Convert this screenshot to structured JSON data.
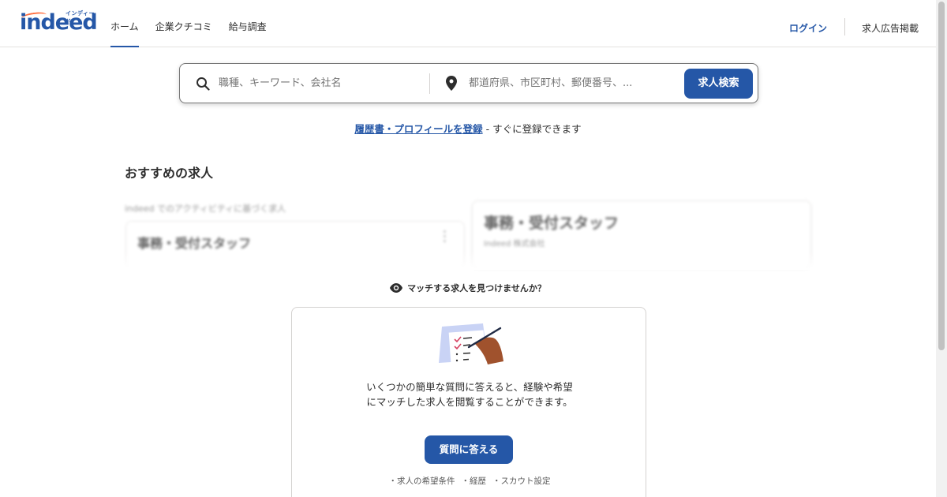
{
  "header": {
    "logo_text": "indeed",
    "logo_kana": "インディード",
    "nav": [
      {
        "label": "ホーム",
        "active": true
      },
      {
        "label": "企業クチコミ",
        "active": false
      },
      {
        "label": "給与調査",
        "active": false
      }
    ],
    "login_label": "ログイン",
    "employer_label": "求人広告掲載"
  },
  "search": {
    "what_placeholder": "職種、キーワード、会社名",
    "where_placeholder": "都道府県、市区町村、郵便番号、...",
    "button_label": "求人検索",
    "what_icon": "search-icon",
    "where_icon": "location-pin-icon"
  },
  "resume": {
    "link_text": "履歴書・プロフィールを登録",
    "rest_text": " - すぐに登録できます"
  },
  "recommended": {
    "title": "おすすめの求人",
    "subheading": "indeed でのアクティビティに基づく求人",
    "cards": [
      {
        "title": "事務・受付スタッフ"
      },
      {
        "title": "事務・受付スタッフ",
        "company": "Indeed 株式会社"
      }
    ]
  },
  "match": {
    "text": "マッチする求人を見つけませんか？",
    "icon": "eye-icon"
  },
  "questionnaire": {
    "illustration": "checklist-pen-illustration",
    "text": "いくつかの簡単な質問に答えると、経験や希望にマッチした求人を閲覧することができます。",
    "button_label": "質問に答える",
    "footer_items": [
      "・求人の希望条件",
      "・経歴",
      "・スカウト設定"
    ]
  },
  "colors": {
    "brand": "#2557a7",
    "accent_orange": "#ff6f3f",
    "text": "#2d2d2d",
    "muted": "#767676",
    "border": "#d4d2d0"
  },
  "progress_fraction": 0.2
}
